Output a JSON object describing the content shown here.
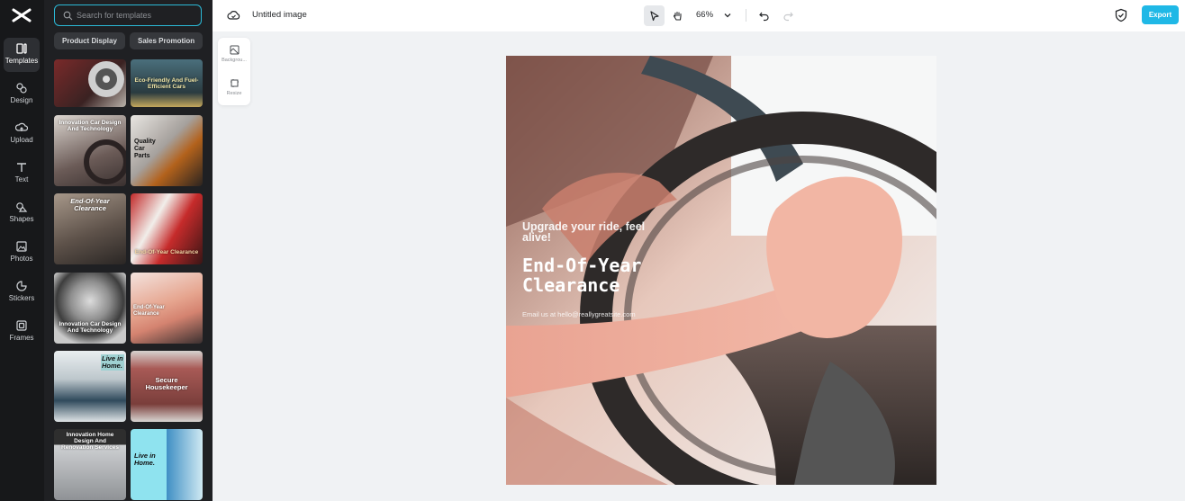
{
  "rail": {
    "items": [
      {
        "label": "Templates",
        "icon": "templates-icon"
      },
      {
        "label": "Design",
        "icon": "design-icon"
      },
      {
        "label": "Upload",
        "icon": "upload-icon"
      },
      {
        "label": "Text",
        "icon": "text-icon"
      },
      {
        "label": "Shapes",
        "icon": "shapes-icon"
      },
      {
        "label": "Photos",
        "icon": "photos-icon"
      },
      {
        "label": "Stickers",
        "icon": "stickers-icon"
      },
      {
        "label": "Frames",
        "icon": "frames-icon"
      }
    ]
  },
  "panel": {
    "search_placeholder": "Search for templates",
    "chips": [
      "Product Display",
      "Sales Promotion"
    ],
    "templates": [
      {
        "title": ""
      },
      {
        "title": "Eco-Friendly And Fuel-Efficient Cars"
      },
      {
        "title": "Innovation Car Design And Technology"
      },
      {
        "title": "Quality Car Parts"
      },
      {
        "title": "End-Of-Year Clearance"
      },
      {
        "title": "End-Of-Year Clearance"
      },
      {
        "title": "Innovation Car Design And Technology"
      },
      {
        "title": "End-Of-Year Clearance"
      },
      {
        "title": "Live in Home."
      },
      {
        "title": "Secure Housekeeper"
      },
      {
        "title": "Innovation Home Design And Renovation Services"
      },
      {
        "title": "Live in Home."
      }
    ]
  },
  "topbar": {
    "title": "Untitled image",
    "zoom": "66%",
    "export_label": "Export"
  },
  "float_panel": {
    "items": [
      "Backgrou...",
      "Resize"
    ]
  },
  "canvas": {
    "subheading": "Upgrade your ride, feel alive!",
    "heading": "End-Of-Year Clearance",
    "email": "Email us at hello@reallygreatsite.com"
  },
  "colors": {
    "accent": "#1fb8e6",
    "rail_bg": "#17181a",
    "panel_bg": "#1f2023"
  }
}
